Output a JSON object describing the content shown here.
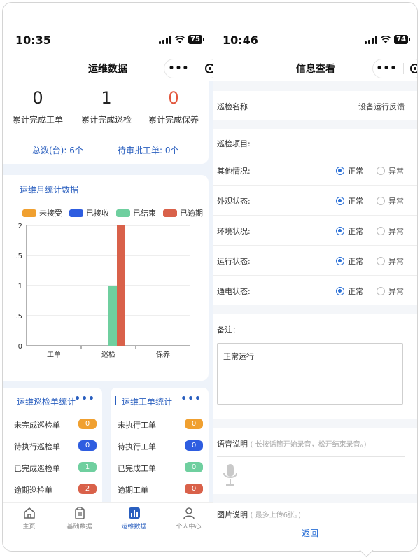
{
  "left": {
    "status": {
      "time": "10:35",
      "battery": "75"
    },
    "nav": {
      "title": "运维数据"
    },
    "summary": {
      "stats": [
        {
          "value": "0",
          "label": "累计完成工单"
        },
        {
          "value": "1",
          "label": "累计完成巡检"
        },
        {
          "value": "0",
          "label": "累计完成保养"
        }
      ],
      "total_label": "总数(台):",
      "total_value": "6个",
      "pending_label": "待审批工单:",
      "pending_value": "0个"
    },
    "chart_card": {
      "title": "运维月统计数据"
    },
    "mini_left": {
      "title": "运维巡检单统计",
      "rows": [
        {
          "label": "未完成巡检单",
          "value": "0"
        },
        {
          "label": "待执行巡检单",
          "value": "0"
        },
        {
          "label": "已完成巡检单",
          "value": "1"
        },
        {
          "label": "逾期巡检单",
          "value": "2"
        }
      ]
    },
    "mini_right": {
      "title": "运维工单统计",
      "rows": [
        {
          "label": "未执行工单",
          "value": "0"
        },
        {
          "label": "待执行工单",
          "value": "0"
        },
        {
          "label": "已完成工单",
          "value": "0"
        },
        {
          "label": "逾期工单",
          "value": "0"
        }
      ]
    },
    "tabs": [
      {
        "label": "主页",
        "icon": "home-icon"
      },
      {
        "label": "基础数据",
        "icon": "clipboard-icon"
      },
      {
        "label": "运维数据",
        "icon": "bar-chart-icon"
      },
      {
        "label": "个人中心",
        "icon": "user-icon"
      }
    ]
  },
  "right": {
    "status": {
      "time": "10:46",
      "battery": "74"
    },
    "nav": {
      "title": "信息查看"
    },
    "inspect_name_label": "巡检名称",
    "inspect_name_value": "设备运行反馈",
    "items_header": "巡检项目:",
    "items": [
      {
        "label": "其他情况:",
        "normal": "正常",
        "abnormal": "异常"
      },
      {
        "label": "外观状态:",
        "normal": "正常",
        "abnormal": "异常"
      },
      {
        "label": "环境状况:",
        "normal": "正常",
        "abnormal": "异常"
      },
      {
        "label": "运行状态:",
        "normal": "正常",
        "abnormal": "异常"
      },
      {
        "label": "通电状态:",
        "normal": "正常",
        "abnormal": "异常"
      }
    ],
    "remark_label": "备注：",
    "remark_text": "正常运行",
    "voice_label": "语音说明",
    "voice_hint": "( 长按话筒开始录音，松开结束录音。)",
    "image_label": "图片说明",
    "image_hint": "( 最多上传6张。)",
    "back": "返回"
  },
  "colors": {
    "not_received": "#f0a030",
    "received": "#2e5de0",
    "finished": "#6fcf9f",
    "overdue": "#d9614a",
    "accent": "#2a5fbf"
  },
  "chart_data": {
    "type": "bar",
    "categories": [
      "工单",
      "巡检",
      "保养"
    ],
    "series": [
      {
        "name": "未接受",
        "values": [
          0,
          0,
          0
        ],
        "color": "#f0a030"
      },
      {
        "name": "已接收",
        "values": [
          0,
          0,
          0
        ],
        "color": "#2e5de0"
      },
      {
        "name": "已结束",
        "values": [
          0,
          1,
          0
        ],
        "color": "#6fcf9f"
      },
      {
        "name": "已逾期",
        "values": [
          0,
          2,
          0
        ],
        "color": "#d9614a"
      }
    ],
    "y_ticks": [
      "0",
      ".5",
      "1",
      ".5",
      "2"
    ],
    "ylim": [
      0,
      2
    ],
    "grid": true,
    "legend_position": "top"
  }
}
